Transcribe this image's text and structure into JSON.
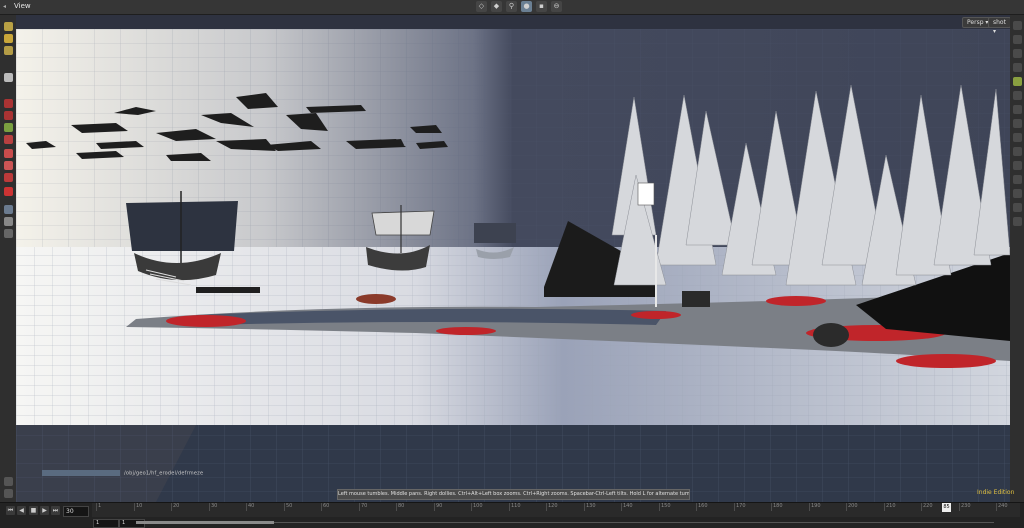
{
  "window": {
    "title": "View"
  },
  "viewport_menus": {
    "camera": "Persp ▾",
    "display": "shot ▾"
  },
  "network_path": "/obj/geo1/hf_erodel/defrmeze",
  "status_hint": "Left mouse tumbles. Middle pans. Right dollies. Ctrl+Alt+Left box zooms. Ctrl+Right zooms. Spacebar-Ctrl-Left tilts. Hold L for alternate tumble, dolly, and zoom.",
  "edition_badge": "Indie Edition",
  "playbar": {
    "current_frame": "30",
    "range_start": "1",
    "range_end": "1",
    "cursor_frame": "85",
    "ticks": [
      "1",
      "10",
      "20",
      "30",
      "40",
      "50",
      "60",
      "70",
      "80",
      "90",
      "100",
      "110",
      "120",
      "130",
      "140",
      "150",
      "160",
      "170",
      "180",
      "190",
      "200",
      "210",
      "220",
      "230",
      "240"
    ]
  },
  "icons": {
    "left_shelf": [
      "select-icon",
      "move-icon",
      "rotate-icon",
      "scale-icon",
      "handle-icon",
      "pose-icon",
      "paint-icon",
      "brush-icon",
      "measure-icon",
      "light-icon",
      "camera-icon",
      "render-icon"
    ],
    "right_shelf": [
      "display-options-icon",
      "shading-icon",
      "wireframe-icon",
      "lighting-icon",
      "bounding-box-icon",
      "grid-icon",
      "snap-icon",
      "ghost-icon",
      "background-icon",
      "safe-area-icon",
      "template-icon"
    ]
  }
}
